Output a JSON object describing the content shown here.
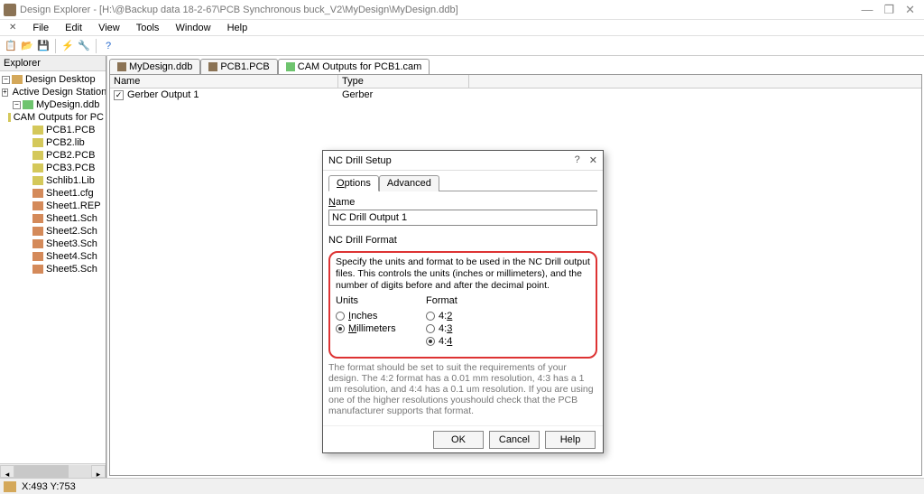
{
  "titlebar": {
    "text": "Design Explorer - [H:\\@Backup data 18-2-67\\PCB Synchronous buck_V2\\MyDesign\\MyDesign.ddb]"
  },
  "menu": {
    "file": "File",
    "edit": "Edit",
    "view": "View",
    "tools": "Tools",
    "window": "Window",
    "help": "Help"
  },
  "explorer": {
    "title": "Explorer",
    "root": "Design Desktop",
    "stations": "Active Design Stations",
    "ddb": "MyDesign.ddb",
    "items": [
      "CAM Outputs for PC",
      "PCB1.PCB",
      "PCB2.lib",
      "PCB2.PCB",
      "PCB3.PCB",
      "Schlib1.Lib",
      "Sheet1.cfg",
      "Sheet1.REP",
      "Sheet1.Sch",
      "Sheet2.Sch",
      "Sheet3.Sch",
      "Sheet4.Sch",
      "Sheet5.Sch"
    ]
  },
  "tabs": {
    "t1": "MyDesign.ddb",
    "t2": "PCB1.PCB",
    "t3": "CAM Outputs for PCB1.cam"
  },
  "grid": {
    "head_name": "Name",
    "head_type": "Type",
    "row1_name": "Gerber Output 1",
    "row1_type": "Gerber"
  },
  "status": {
    "coords": "X:493 Y:753"
  },
  "dialog": {
    "title": "NC Drill Setup",
    "tab_options": "Options",
    "tab_adv": "Advanced",
    "name_label": "Name",
    "name_value": "NC Drill Output 1",
    "format_title": "NC Drill Format",
    "desc": "Specify the units and format to be used in the NC Drill output files. This controls the units (inches or millimeters), and the number of digits before and after the decimal point.",
    "units_label": "Units",
    "inches": "Inches",
    "mm": "Millimeters",
    "format_label": "Format",
    "f42": "4:2",
    "f43": "4:3",
    "f44": "4:4",
    "note": "The format should be set to suit the requirements of your design. The 4:2 format has a 0.01 mm resolution, 4:3 has a 1 um resolution, and 4:4 has a 0.1 um resolution. If you are using one of the higher resolutions youshould check that the PCB manufacturer supports that format.",
    "ok": "OK",
    "cancel": "Cancel",
    "help": "Help"
  }
}
